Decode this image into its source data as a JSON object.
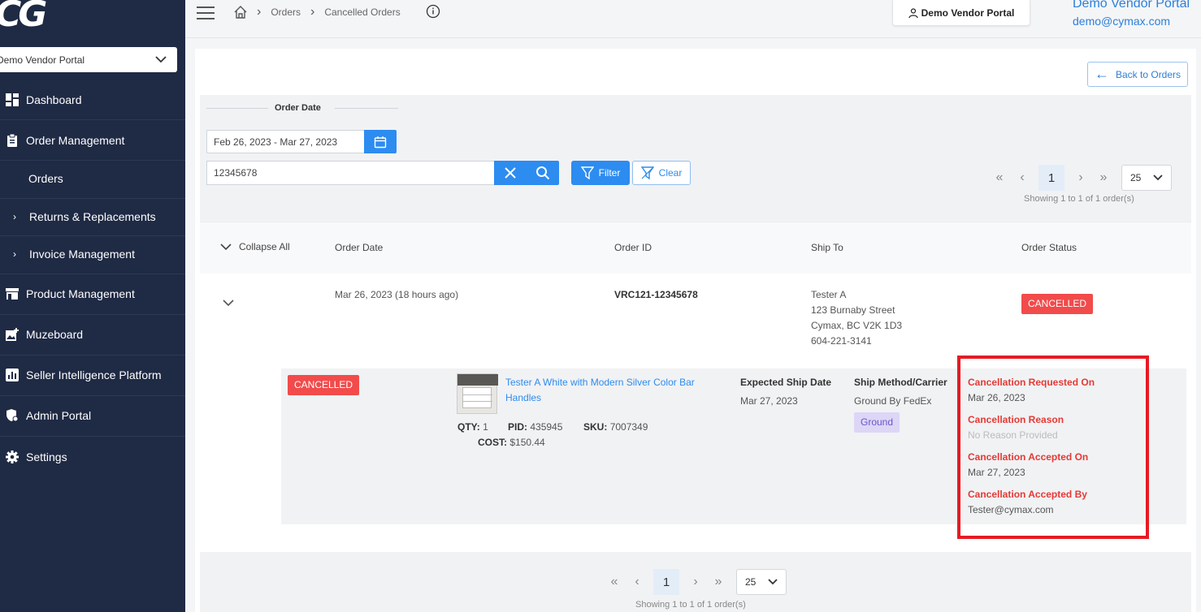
{
  "sidebar": {
    "logo": "CG",
    "portal_select": "Demo Vendor Portal",
    "items": [
      {
        "label": "Dashboard"
      },
      {
        "label": "Order Management"
      },
      {
        "label": "Orders"
      },
      {
        "label": "Returns & Replacements"
      },
      {
        "label": "Invoice Management"
      },
      {
        "label": "Product Management"
      },
      {
        "label": "Muzeboard"
      },
      {
        "label": "Seller Intelligence Platform"
      },
      {
        "label": "Admin Portal"
      },
      {
        "label": "Settings"
      }
    ]
  },
  "header": {
    "breadcrumb": [
      "Orders",
      "Cancelled Orders"
    ],
    "vendor_button": "Demo Vendor Portal",
    "user_name": "Demo Vendor Portal",
    "user_email": "demo@cymax.com"
  },
  "main": {
    "back_button": "Back to Orders",
    "filters": {
      "order_date_label": "Order Date",
      "date_range": "Feb 26, 2023 - Mar 27, 2023",
      "search_value": "12345678",
      "filter_label": "Filter",
      "clear_label": "Clear"
    },
    "pagination": {
      "current_page": "1",
      "page_size": "25",
      "showing": "Showing 1 to 1 of 1 order(s)"
    },
    "table": {
      "collapse_all": "Collapse All",
      "columns": [
        "Order Date",
        "Order ID",
        "Ship To",
        "Order Status"
      ]
    },
    "order": {
      "date": "Mar 26, 2023 (18 hours ago)",
      "id": "VRC121-12345678",
      "ship_to": [
        "Tester A",
        "123 Burnaby Street",
        "Cymax, BC V2K 1D3",
        "604-221-3141"
      ],
      "status": "CANCELLED",
      "item": {
        "status": "CANCELLED",
        "title_line1": "Tester A White with Modern Silver Color Bar",
        "title_line2": "Handles",
        "qty_label": "QTY:",
        "qty": "1",
        "pid_label": "PID:",
        "pid": "435945",
        "sku_label": "SKU:",
        "sku": "7007349",
        "cost_label": "COST:",
        "cost": "$150.44",
        "expected_ship_label": "Expected Ship Date",
        "expected_ship": "Mar 27, 2023",
        "ship_method_label": "Ship Method/Carrier",
        "ship_method": "Ground By FedEx",
        "ship_tag": "Ground"
      },
      "cancellation": {
        "requested_on_label": "Cancellation Requested On",
        "requested_on": "Mar 26, 2023",
        "reason_label": "Cancellation Reason",
        "reason": "No Reason Provided",
        "accepted_on_label": "Cancellation Accepted On",
        "accepted_on": "Mar 27, 2023",
        "accepted_by_label": "Cancellation Accepted By",
        "accepted_by": "Tester@cymax.com"
      }
    }
  },
  "colors": {
    "sidebar_bg": "#1f2a44",
    "accent": "#2d8cf0",
    "cancelled": "#f24b4b",
    "highlight_box": "#e51b23"
  }
}
